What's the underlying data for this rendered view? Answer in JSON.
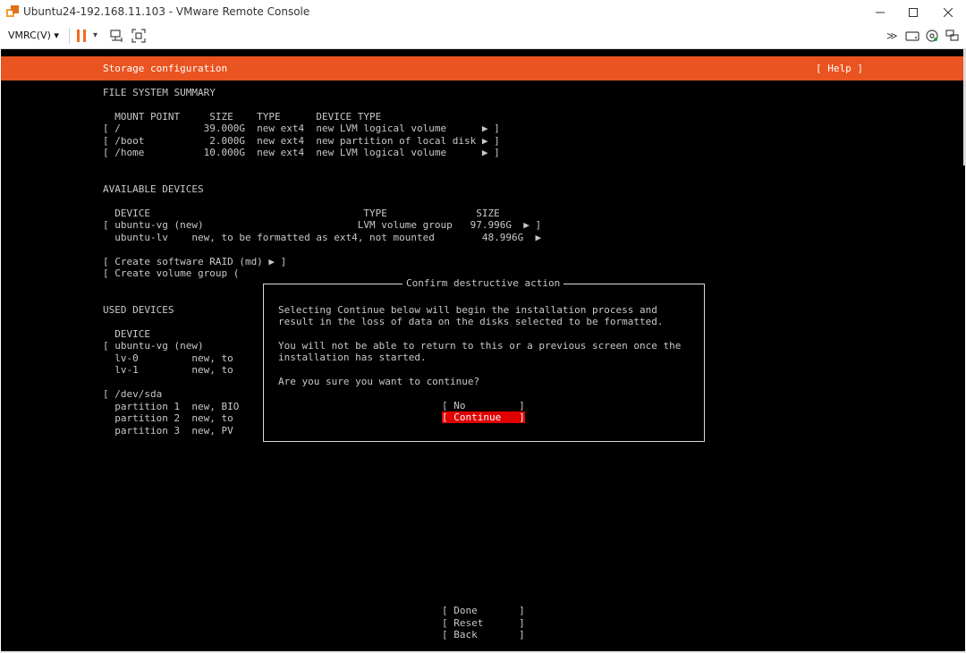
{
  "window": {
    "title": "Ubuntu24-192.168.11.103 - VMware Remote Console",
    "minimize_icon": "minimize-icon",
    "maximize_icon": "maximize-icon",
    "close_icon": "close-icon"
  },
  "toolbar": {
    "menu_label": "VMRC(V)",
    "chevron": "▾",
    "pause_dropdown": "▾",
    "more": "≫"
  },
  "installer": {
    "title": "Storage configuration",
    "help": "[ Help ]",
    "fs_summary": {
      "heading": "FILE SYSTEM SUMMARY",
      "header_line": "  MOUNT POINT     SIZE    TYPE      DEVICE TYPE",
      "rows": [
        "[ /              39.000G  new ext4  new LVM logical volume      ▶ ]",
        "[ /boot           2.000G  new ext4  new partition of local disk ▶ ]",
        "[ /home          10.000G  new ext4  new LVM logical volume      ▶ ]"
      ]
    },
    "available": {
      "heading": "AVAILABLE DEVICES",
      "header_line": "  DEVICE                                    TYPE               SIZE",
      "rows": [
        "[ ubuntu-vg (new)                          LVM volume group   97.996G  ▶ ]",
        "  ubuntu-lv    new, to be formatted as ext4, not mounted        48.996G  ▶"
      ],
      "actions": [
        "[ Create software RAID (md) ▶ ]",
        "[ Create volume group ("
      ]
    },
    "used": {
      "heading": "USED DEVICES",
      "header_line": "  DEVICE",
      "rows": [
        "[ ubuntu-vg (new)",
        "  lv-0         new, to",
        "  lv-1         new, to",
        "",
        "[ /dev/sda",
        "  partition 1  new, BIO",
        "  partition 2  new, to",
        "  partition 3  new, PV"
      ]
    },
    "dialog": {
      "title": "Confirm destructive action",
      "lines": [
        "Selecting Continue below will begin the installation process and",
        "result in the loss of data on the disks selected to be formatted.",
        "",
        "You will not be able to return to this or a previous screen once the",
        "installation has started.",
        "",
        "Are you sure you want to continue?"
      ],
      "no_button": "[ No         ]",
      "continue_button": "[ Continue   ]"
    },
    "footer": {
      "done": "[ Done       ]",
      "reset": "[ Reset      ]",
      "back": "[ Back       ]"
    }
  },
  "colors": {
    "header_orange": "#e95420",
    "selected_red": "#e00000",
    "pause_orange": "#ef6c23"
  }
}
